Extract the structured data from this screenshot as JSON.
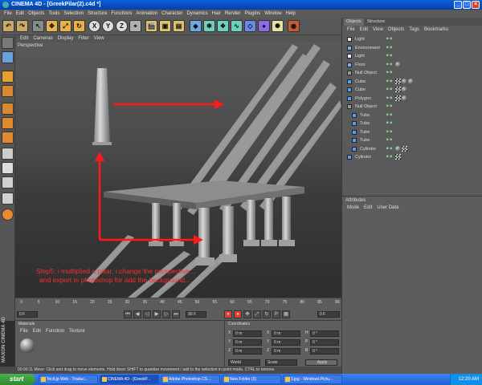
{
  "window": {
    "title": "CINEMA 4D - [GreekPilar(2).c4d *]"
  },
  "menu": [
    "File",
    "Edit",
    "Objects",
    "Tools",
    "Selection",
    "Structure",
    "Functions",
    "Animation",
    "Character",
    "Dynamics",
    "Hair",
    "Render",
    "Plugins",
    "Window",
    "Help"
  ],
  "toolbar": {
    "axis_x": "X",
    "axis_y": "Y",
    "axis_z": "Z"
  },
  "viewport": {
    "menu": [
      "Edit",
      "Cameras",
      "Display",
      "Filter",
      "View"
    ],
    "label": "Perspective",
    "caption_line1": "Step5: i multiplied a pillar, i change the perspective...",
    "caption_line2": "and  export in photoshop for add the background...."
  },
  "timeline": {
    "ticks": [
      "0",
      "5",
      "10",
      "15",
      "20",
      "25",
      "30",
      "35",
      "40",
      "45",
      "50",
      "55",
      "60",
      "65",
      "70",
      "75",
      "80",
      "85",
      "90"
    ],
    "frame_field": "0 F",
    "start_field": "0 F",
    "end_field": "90 F"
  },
  "objects_panel": {
    "tabs": [
      "Objects",
      "Structure"
    ],
    "menu": [
      "File",
      "Edit",
      "View",
      "Objects",
      "Tags",
      "Bookmarks"
    ],
    "items": [
      {
        "name": "Light",
        "indent": 0,
        "icon_color": "#e8e8e8",
        "tags": []
      },
      {
        "name": "Environment",
        "indent": 0,
        "icon_color": "#7fb4e8",
        "tags": []
      },
      {
        "name": "Light",
        "indent": 0,
        "icon_color": "#e8e8e8",
        "tags": []
      },
      {
        "name": "Floor",
        "indent": 0,
        "icon_color": "#7fb4e8",
        "tags": [
          "sphere"
        ]
      },
      {
        "name": "Null Object",
        "indent": 0,
        "icon_color": "#9a9a9a",
        "tags": []
      },
      {
        "name": "Cube",
        "indent": 0,
        "icon_color": "#5aa0e8",
        "tags": [
          "checker",
          "sphere",
          "sphere"
        ]
      },
      {
        "name": "Cube",
        "indent": 0,
        "icon_color": "#5aa0e8",
        "tags": [
          "checker",
          "sphere"
        ]
      },
      {
        "name": "Polygon",
        "indent": 0,
        "icon_color": "#5aa0e8",
        "tags": [
          "checker",
          "sphere"
        ]
      },
      {
        "name": "Null Object",
        "indent": 0,
        "icon_color": "#9a9a9a",
        "tags": []
      },
      {
        "name": "Tube",
        "indent": 1,
        "icon_color": "#5aa0e8",
        "tags": []
      },
      {
        "name": "Tube",
        "indent": 1,
        "icon_color": "#5aa0e8",
        "tags": []
      },
      {
        "name": "Tube",
        "indent": 1,
        "icon_color": "#5aa0e8",
        "tags": []
      },
      {
        "name": "Tube",
        "indent": 1,
        "icon_color": "#5aa0e8",
        "tags": []
      },
      {
        "name": "Cylinder",
        "indent": 1,
        "icon_color": "#5aa0e8",
        "tags": [
          "sphere",
          "checker"
        ]
      },
      {
        "name": "Cylinder",
        "indent": 0,
        "icon_color": "#5aa0e8",
        "tags": [
          "checker"
        ]
      }
    ]
  },
  "attributes_panel": {
    "title": "Attributes",
    "menu": [
      "Mode",
      "Edit",
      "User Data"
    ]
  },
  "materials_panel": {
    "title": "Materials",
    "menu": [
      "File",
      "Edit",
      "Function",
      "Texture"
    ]
  },
  "coordinates_panel": {
    "title": "Coordinates",
    "rows": [
      [
        "X",
        "0 m",
        "X",
        "0 m",
        "H",
        "0 °"
      ],
      [
        "Y",
        "0 m",
        "Y",
        "0 m",
        "P",
        "0 °"
      ],
      [
        "Z",
        "0 m",
        "Z",
        "0 m",
        "B",
        "0 °"
      ]
    ],
    "world": "World",
    "scale": "Scale",
    "apply": "Apply"
  },
  "brand": "MAXON CINEMA 4D",
  "statusbar": {
    "text": "00:00:11  Move: Click and drag to move elements. Hold down SHIFT to quantize movement / add to the selection in point mode, CTRL to remove."
  },
  "taskbar": {
    "start": "start",
    "tasks": [
      "Tecit.jp Web - Traduc...",
      "CINEMA 4D - [GreekP...",
      "Adobe Photoshop CS...",
      "New Folder (3)",
      "3.jpg - Windows Pictu..."
    ],
    "clock": "12:20 AM"
  }
}
